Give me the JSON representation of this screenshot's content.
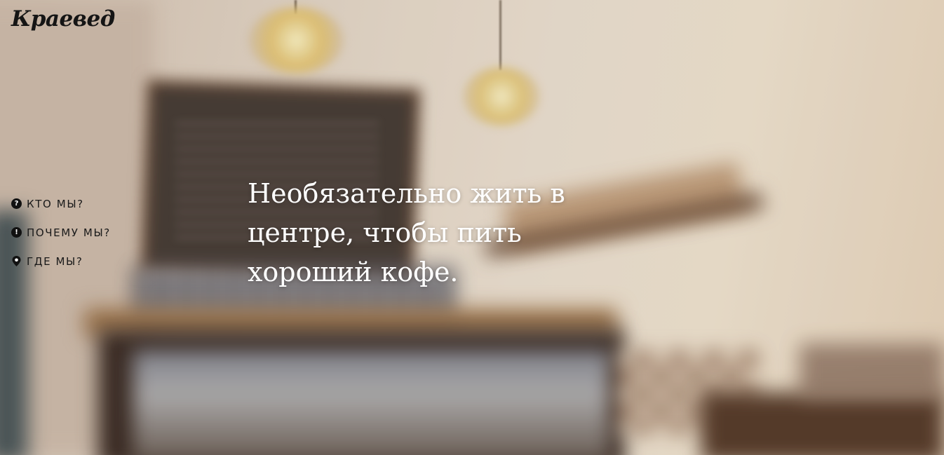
{
  "brand": {
    "logo_text": "Краевед"
  },
  "nav": {
    "items": [
      {
        "icon": "question-icon",
        "icon_glyph": "?",
        "label": "КТО МЫ?"
      },
      {
        "icon": "exclamation-icon",
        "icon_glyph": "!",
        "label": "ПОЧЕМУ МЫ?"
      },
      {
        "icon": "map-pin-icon",
        "icon_glyph": "",
        "label": "ГДЕ МЫ?"
      }
    ]
  },
  "hero": {
    "headline": "Необязательно жить в центре, чтобы пить хороший кофе."
  },
  "colors": {
    "text_dark": "#1a1a1a",
    "headline": "#ffffff"
  }
}
